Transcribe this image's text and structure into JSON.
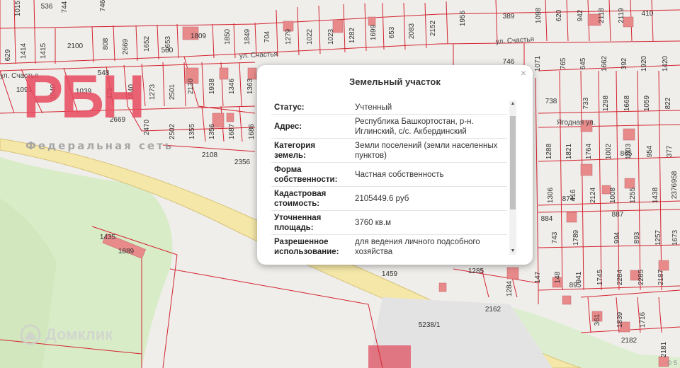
{
  "map": {
    "plot_numbers": [
      "1015",
      "536",
      "744",
      "746",
      "389",
      "1098",
      "620",
      "942",
      "2118",
      "2119",
      "410",
      "1414",
      "1415",
      "2100",
      "808",
      "2669",
      "1652",
      "1653",
      "530",
      "1809",
      "1850",
      "1849",
      "704",
      "1279",
      "1022",
      "1023",
      "1282",
      "1699",
      "653",
      "2083",
      "2152",
      "1956",
      "629",
      "1091",
      "1039",
      "1040",
      "475",
      "1940",
      "1273",
      "2501",
      "2130",
      "1938",
      "1346",
      "1363",
      "548",
      "746",
      "1071",
      "765",
      "645",
      "1662",
      "392",
      "1920",
      "1420",
      "738",
      "733",
      "1298",
      "1668",
      "1059",
      "822",
      "2669",
      "2470",
      "2502",
      "1355",
      "1356",
      "1687",
      "1686",
      "1288",
      "1821",
      "1764",
      "1002",
      "1003",
      "865",
      "954",
      "377",
      "958",
      "2376",
      "2108",
      "2356",
      "1306",
      "416",
      "874",
      "2124",
      "1008",
      "1255",
      "1438",
      "884",
      "743",
      "1789",
      "887",
      "994",
      "893",
      "1257",
      "1673",
      "1435",
      "1889",
      "1459",
      "1285",
      "1284",
      "147",
      "148",
      "941",
      "1745",
      "2284",
      "2285",
      "2187",
      "895",
      "2162",
      "5238/1",
      "361",
      "1839",
      "1716",
      "2182",
      "2181"
    ],
    "streets": [
      "ул. Счастья",
      "ул. Счастья",
      "ул. Счастья",
      "Ягодная ул."
    ]
  },
  "watermark": {
    "logo": "РБН",
    "subtitle": "Федеральная сеть"
  },
  "brand": {
    "name": "Домклик"
  },
  "popup": {
    "title": "Земельный участок",
    "close_icon": "×",
    "rows": [
      {
        "key": "Статус:",
        "value": "Учтенный"
      },
      {
        "key": "Адрес:",
        "value": "Республика Башкортостан, р-н. Иглинский, с/с. Акбердинский"
      },
      {
        "key": "Категория земель:",
        "value": "Земли поселений (земли населенных пунктов)"
      },
      {
        "key": "Форма собственности:",
        "value": "Частная собственность"
      },
      {
        "key": "Кадастровая стоимость:",
        "value": "2105449.6 руб"
      },
      {
        "key": "Уточненная площадь:",
        "value": "3760 кв.м"
      },
      {
        "key": "Разрешенное использование:",
        "value": "для ведения личного подсобного хозяйства"
      }
    ]
  },
  "attribution": "© 5",
  "colors": {
    "parcel_line": "#d4232f",
    "building": "#e88a8a",
    "road": "#f5e7a8",
    "forest": "#d9ecc8"
  }
}
